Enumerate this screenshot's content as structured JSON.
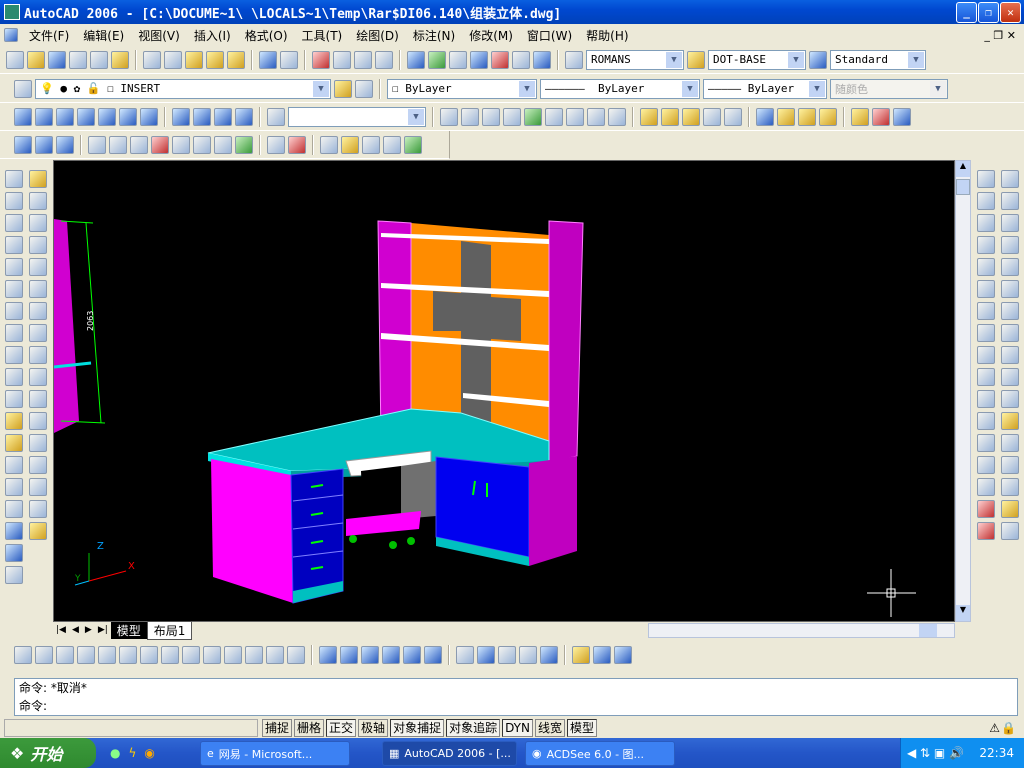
{
  "title": "AutoCAD 2006 - [C:\\DOCUME~1\\      \\LOCALS~1\\Temp\\Rar$DI06.140\\组装立体.dwg]",
  "menu": [
    "文件(F)",
    "编辑(E)",
    "视图(V)",
    "插入(I)",
    "格式(O)",
    "工具(T)",
    "绘图(D)",
    "标注(N)",
    "修改(M)",
    "窗口(W)",
    "帮助(H)"
  ],
  "styles": {
    "text_style": "ROMANS",
    "dim_style": "DOT-BASE",
    "table_style": "Standard"
  },
  "layers": {
    "current_layer": "INSERT"
  },
  "properties": {
    "color": "ByLayer",
    "linetype": "ByLayer",
    "lineweight": "ByLayer",
    "plotstyle": "随颜色"
  },
  "drawing": {
    "dimension_text": "2063",
    "ucs_x": "X",
    "ucs_y": "Y",
    "ucs_z": "Z"
  },
  "layout_tabs": [
    "模型",
    "布局1"
  ],
  "command": {
    "history": "命令: *取消*",
    "prompt": "命令:"
  },
  "status_buttons": [
    {
      "label": "捕捉",
      "on": false
    },
    {
      "label": "栅格",
      "on": false
    },
    {
      "label": "正交",
      "on": true
    },
    {
      "label": "极轴",
      "on": false
    },
    {
      "label": "对象捕捉",
      "on": true
    },
    {
      "label": "对象追踪",
      "on": true
    },
    {
      "label": "DYN",
      "on": true
    },
    {
      "label": "线宽",
      "on": false
    },
    {
      "label": "模型",
      "on": true
    }
  ],
  "taskbar": {
    "start": "开始",
    "tasks": [
      "网易 - Microsoft...",
      "AutoCAD 2006 - [...",
      "ACDSee 6.0 - 图..."
    ],
    "clock": "22:34"
  },
  "colors": {
    "titlebar": "#0a5fe0",
    "canvas": "#000000",
    "magenta": "#ff00ff",
    "orange": "#ff8c00",
    "cyan": "#00c8c8",
    "blue": "#0000ff"
  }
}
